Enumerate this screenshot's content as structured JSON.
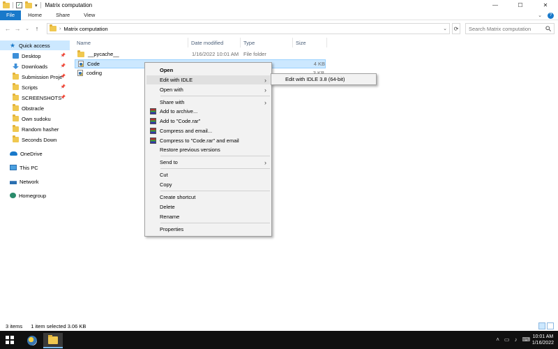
{
  "window": {
    "title": "Matrix computation",
    "controls": {
      "minimize": "—",
      "maximize": "☐",
      "close": "✕"
    }
  },
  "ribbon": {
    "tabs": [
      "File",
      "Home",
      "Share",
      "View"
    ]
  },
  "address": {
    "path": "Matrix computation",
    "search_placeholder": "Search Matrix computation"
  },
  "navpane": {
    "quick_access": "Quick access",
    "pinned": [
      {
        "label": "Desktop",
        "pinned": true,
        "icon": "desktop-icon"
      },
      {
        "label": "Downloads",
        "pinned": true,
        "icon": "downloads-icon"
      },
      {
        "label": "Submission Proje",
        "pinned": true,
        "icon": "folder-icon"
      },
      {
        "label": "Scripts",
        "pinned": true,
        "icon": "folder-icon"
      },
      {
        "label": "SCREENSHOTS",
        "pinned": true,
        "icon": "folder-icon"
      },
      {
        "label": "Obstracle",
        "pinned": false,
        "icon": "folder-icon"
      },
      {
        "label": "Own sudoku",
        "pinned": false,
        "icon": "folder-icon"
      },
      {
        "label": "Random hasher",
        "pinned": false,
        "icon": "folder-icon"
      },
      {
        "label": "Seconds Down",
        "pinned": false,
        "icon": "folder-icon"
      }
    ],
    "onedrive": "OneDrive",
    "this_pc": "This PC",
    "network": "Network",
    "homegroup": "Homegroup"
  },
  "filelist": {
    "columns": {
      "name": "Name",
      "date": "Date modified",
      "type": "Type",
      "size": "Size"
    },
    "rows": [
      {
        "name": "__pycache__",
        "date": "1/16/2022 10:01 AM",
        "type": "File folder",
        "size": ""
      },
      {
        "name": "Code",
        "date": "",
        "type": "",
        "size": "4 KB"
      },
      {
        "name": "coding",
        "date": "",
        "type": "",
        "size": "3 KB"
      }
    ]
  },
  "context_menu": {
    "open": "Open",
    "edit_with_idle": "Edit with IDLE",
    "open_with": "Open with",
    "share_with": "Share with",
    "add_to_archive": "Add to archive...",
    "add_to_rar": "Add to \"Code.rar\"",
    "compress_email": "Compress and email...",
    "compress_rar_email": "Compress to \"Code.rar\" and email",
    "restore": "Restore previous versions",
    "send_to": "Send to",
    "cut": "Cut",
    "copy": "Copy",
    "create_shortcut": "Create shortcut",
    "delete": "Delete",
    "rename": "Rename",
    "properties": "Properties"
  },
  "submenu": {
    "item": "Edit with IDLE 3.8 (64-bit)"
  },
  "status": {
    "items": "3 items",
    "selected": "1 item selected  3.06 KB"
  },
  "taskbar": {
    "time": "10:01 AM",
    "date": "1/16/2022"
  }
}
